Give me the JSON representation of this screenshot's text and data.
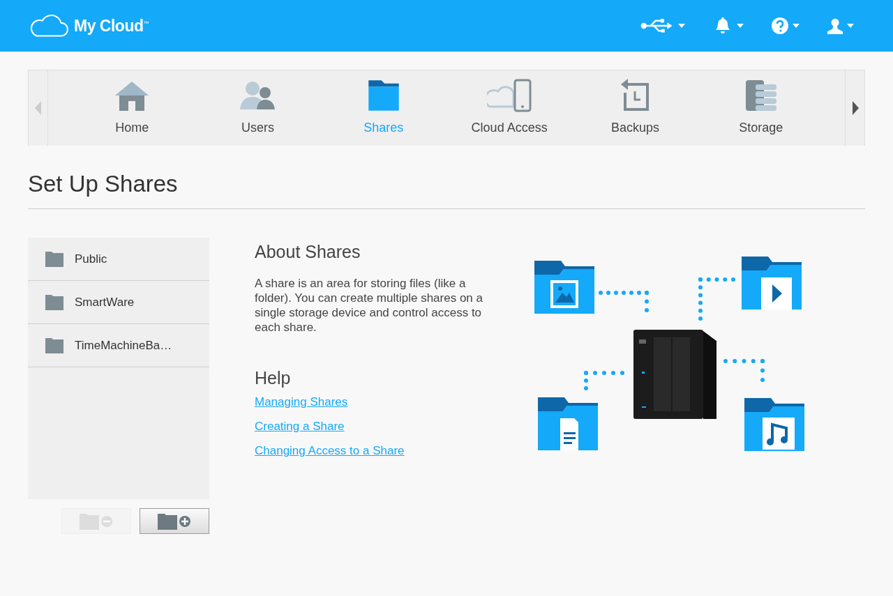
{
  "header": {
    "logo": "My Cloud$^{™}$",
    "icons": [
      {
        "kind": "usb"
      },
      {
        "kind": "bell"
      },
      {
        "kind": "help"
      },
      {
        "kind": "user"
      }
    ]
  },
  "nav": {
    "prev_disabled": true,
    "next_disabled": false,
    "items": [
      {
        "kind": "home",
        "label": "Home",
        "selected": false
      },
      {
        "kind": "users",
        "label": "Users",
        "selected": false
      },
      {
        "kind": "shares",
        "label": "Shares",
        "selected": true
      },
      {
        "kind": "cloud",
        "label": "Cloud Access",
        "selected": false
      },
      {
        "kind": "backups",
        "label": "Backups",
        "selected": false
      },
      {
        "kind": "storage",
        "label": "Storage",
        "selected": false
      }
    ]
  },
  "page_title": "Set Up Shares",
  "shares": [
    {
      "name": "Public"
    },
    {
      "name": "SmartWare"
    },
    {
      "name": "TimeMachineBa…"
    }
  ],
  "share_buttons": [
    {
      "kind": "remove",
      "disabled": true
    },
    {
      "kind": "add",
      "disabled": false
    }
  ],
  "about": {
    "heading": "About Shares",
    "text": "A share is an area for storing files (like a folder). You can create multiple shares on a single storage device and control access to each share."
  },
  "help": {
    "heading": "Help",
    "links": [
      "Managing Shares",
      "Creating a Share",
      "Changing Access to a Share"
    ]
  }
}
